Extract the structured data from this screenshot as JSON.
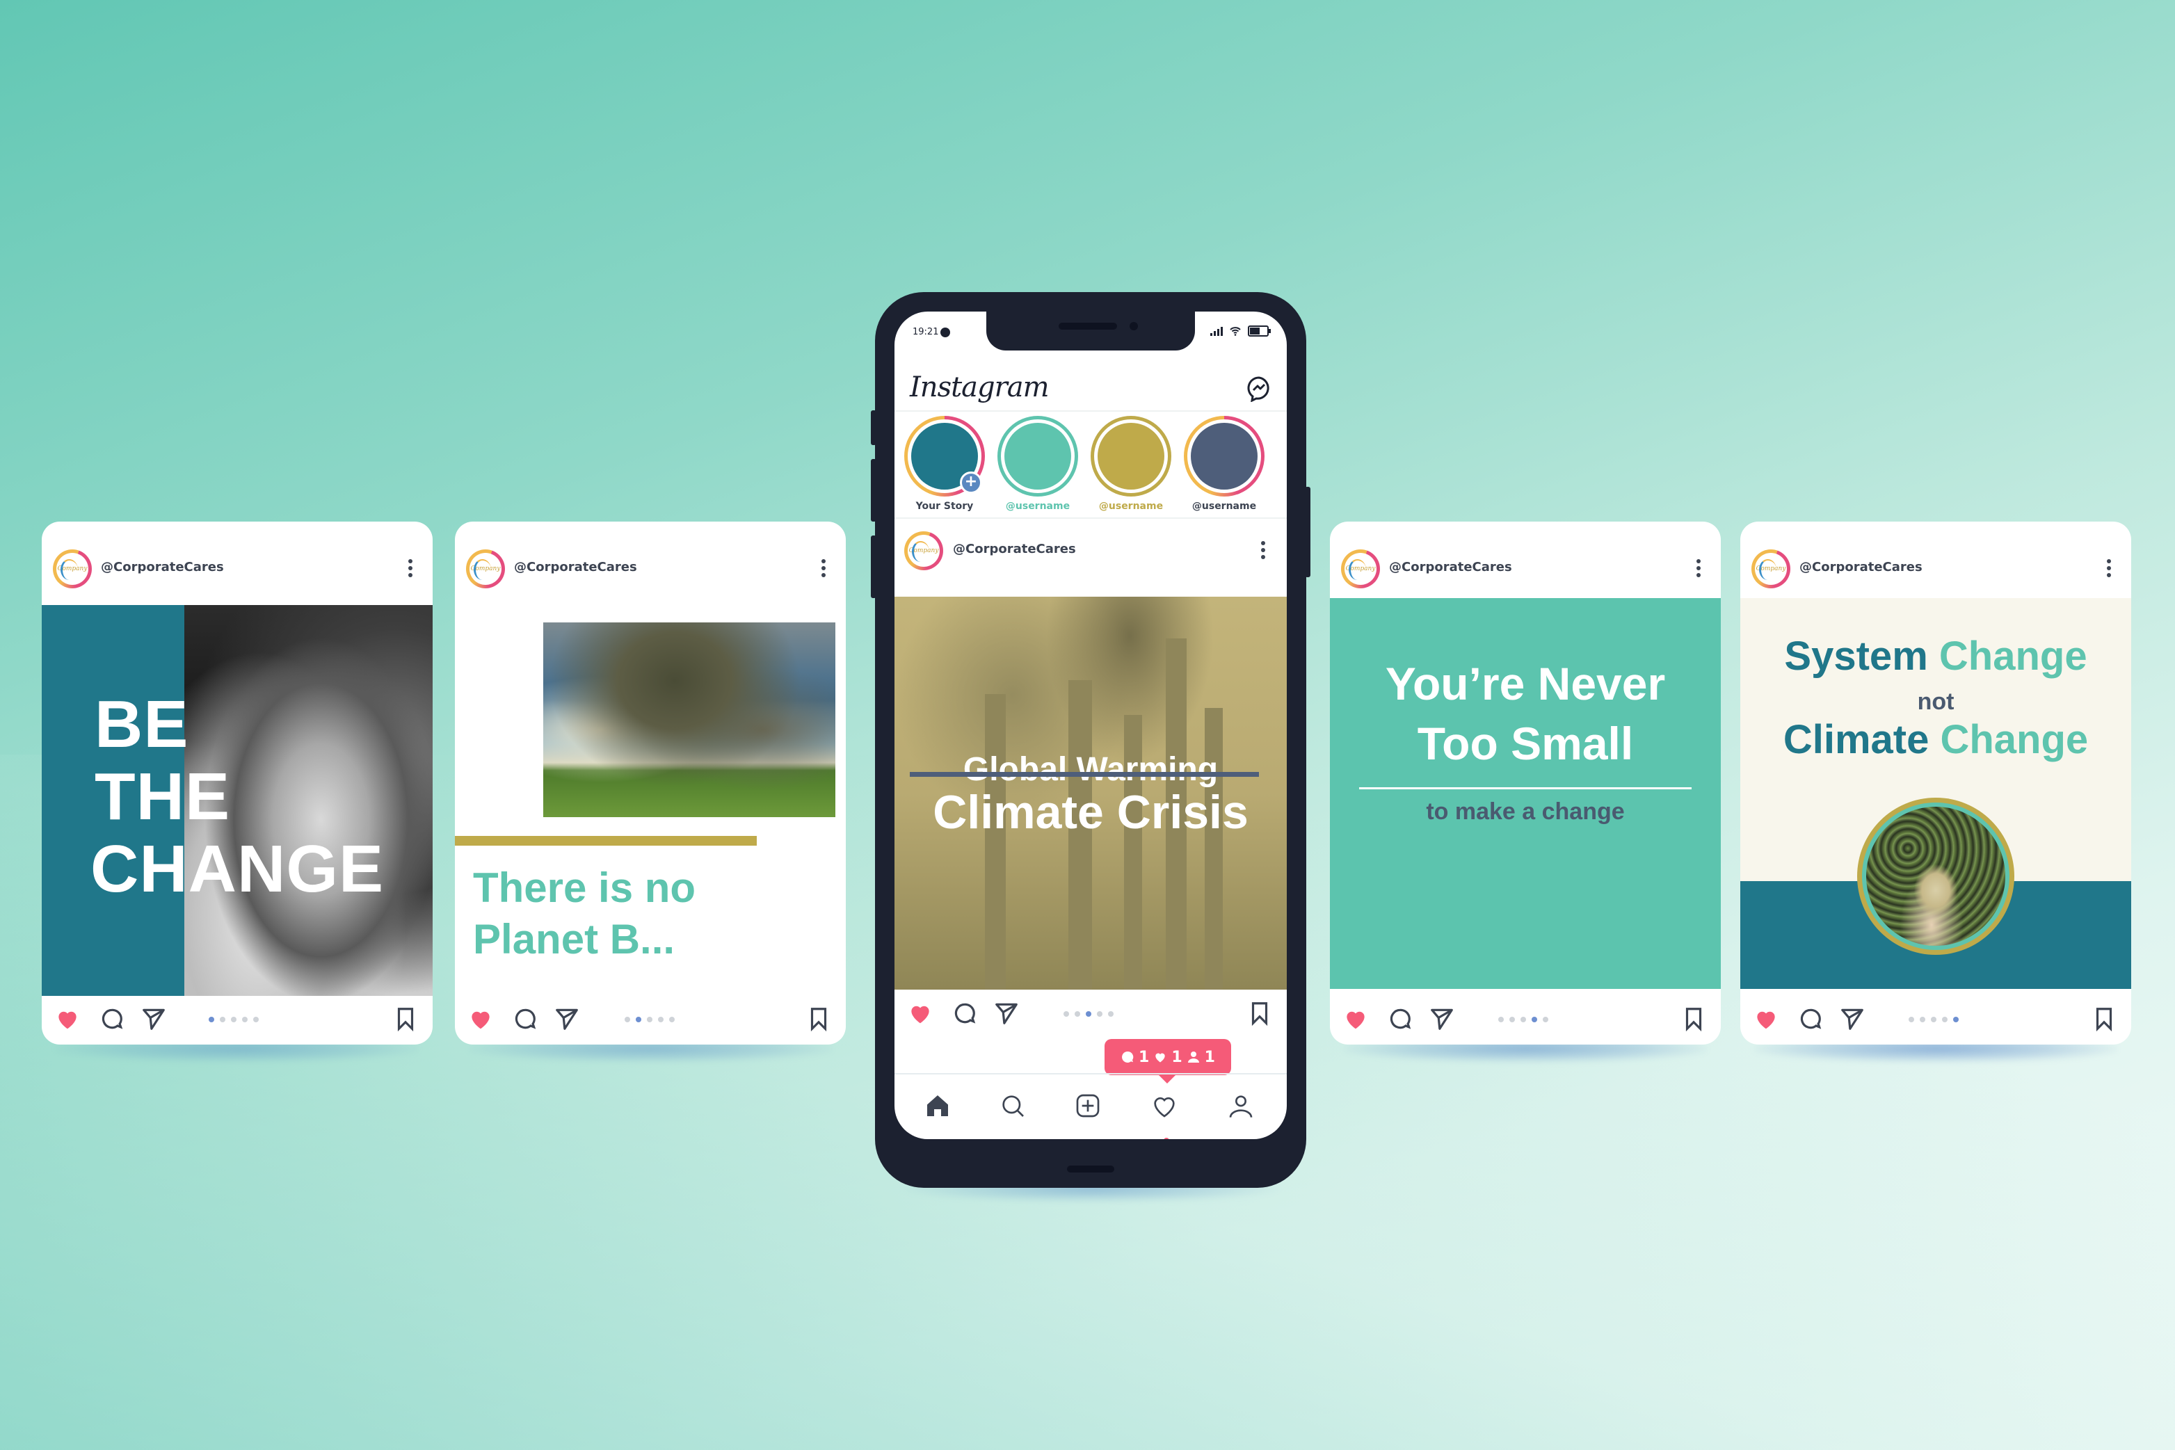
{
  "brand_colors": {
    "teal_dark": "#20778a",
    "teal_light": "#5ec4ae",
    "gold": "#bfaa4a",
    "slate": "#4e5e7a",
    "like_red": "#f55b78",
    "active_dot": "#6d8fd1"
  },
  "account": {
    "handle": "@CorporateCares",
    "logo_text": "Company"
  },
  "phone": {
    "status": {
      "time": "19:21"
    },
    "app_title": "Instagram",
    "icons": {
      "messenger": "messenger-icon"
    },
    "stories": [
      {
        "label": "Your Story",
        "color": "#20778a",
        "label_color": "#3d4452",
        "has_add": true,
        "add_symbol": "+"
      },
      {
        "label": "@username",
        "color": "#5ec4ae",
        "label_color": "#5ec4ae",
        "has_add": false
      },
      {
        "label": "@username",
        "color": "#bfaa4a",
        "label_color": "#bfaa4a",
        "has_add": false
      },
      {
        "label": "@username",
        "color": "#4e5e7a",
        "label_color": "#3d4452",
        "has_add": false
      }
    ],
    "post": {
      "struck_text": "Global Warming",
      "headline": "Climate Crisis",
      "active_slide": 3,
      "slide_count": 5
    },
    "notification": {
      "comments": "1",
      "likes": "1",
      "followers": "1"
    },
    "nav": [
      "home-icon",
      "search-icon",
      "add-post-icon",
      "activity-heart-icon",
      "profile-icon"
    ],
    "active_nav": "home"
  },
  "cards": [
    {
      "id": "be-the-change",
      "lines": [
        "BE",
        "THE",
        "CHANGE"
      ],
      "active_slide": 1,
      "slide_count": 5
    },
    {
      "id": "no-planet-b",
      "lines": [
        "There is no",
        "Planet B..."
      ],
      "active_slide": 2,
      "slide_count": 5
    },
    {
      "id": "never-too-small",
      "lines": [
        "You’re Never",
        "Too Small"
      ],
      "subline": "to make a change",
      "active_slide": 4,
      "slide_count": 5
    },
    {
      "id": "system-change",
      "line1": [
        "System",
        "Change"
      ],
      "line2": "not",
      "line3": [
        "Climate",
        "Change"
      ],
      "active_slide": 5,
      "slide_count": 5
    }
  ]
}
